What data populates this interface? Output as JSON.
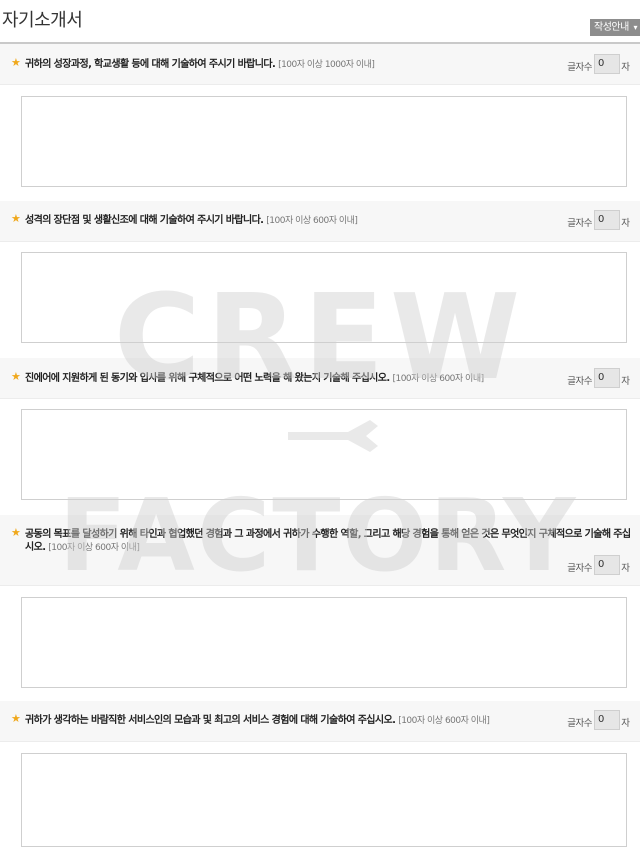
{
  "page": {
    "title": "자기소개서",
    "guide_button": "작성안내",
    "guide_caret": "▾"
  },
  "questions": [
    {
      "text": "귀하의 성장과정, 학교생활 등에 대해 기술하여 주시기 바랍니다.",
      "note": "[100자 이상 1000자 이내]",
      "count_label": "글자수",
      "count": "0",
      "count_unit": "자"
    },
    {
      "text": "성격의 장단점 및 생활신조에 대해 기술하여 주시기 바랍니다.",
      "note": "[100자 이상 600자 이내]",
      "count_label": "글자수",
      "count": "0",
      "count_unit": "자"
    },
    {
      "text": "진에어에 지원하게 된 동기와 입사를 위해 구체적으로 어떤 노력을 해 왔는지 기술해 주십시오.",
      "note": "[100자 이상 600자 이내]",
      "count_label": "글자수",
      "count": "0",
      "count_unit": "자"
    },
    {
      "text": "공동의 목표를 달성하기 위해 타인과 협업했던 경험과 그 과정에서 귀하가 수행한 역할, 그리고 해당 경험을 통해 얻은 것은 무엇인지 구체적으로 기술해 주십시오.",
      "note": "[100자 이상 600자 이내]",
      "count_label": "글자수",
      "count": "0",
      "count_unit": "자"
    },
    {
      "text": "귀하가 생각하는 바람직한 서비스인의 모습과 및 최고의 서비스 경험에 대해 기술하여 주십시오.",
      "note": "[100자 이상 600자 이내]",
      "count_label": "글자수",
      "count": "0",
      "count_unit": "자"
    }
  ],
  "watermark": {
    "line1": "CREW",
    "line2": "FACTORY"
  }
}
